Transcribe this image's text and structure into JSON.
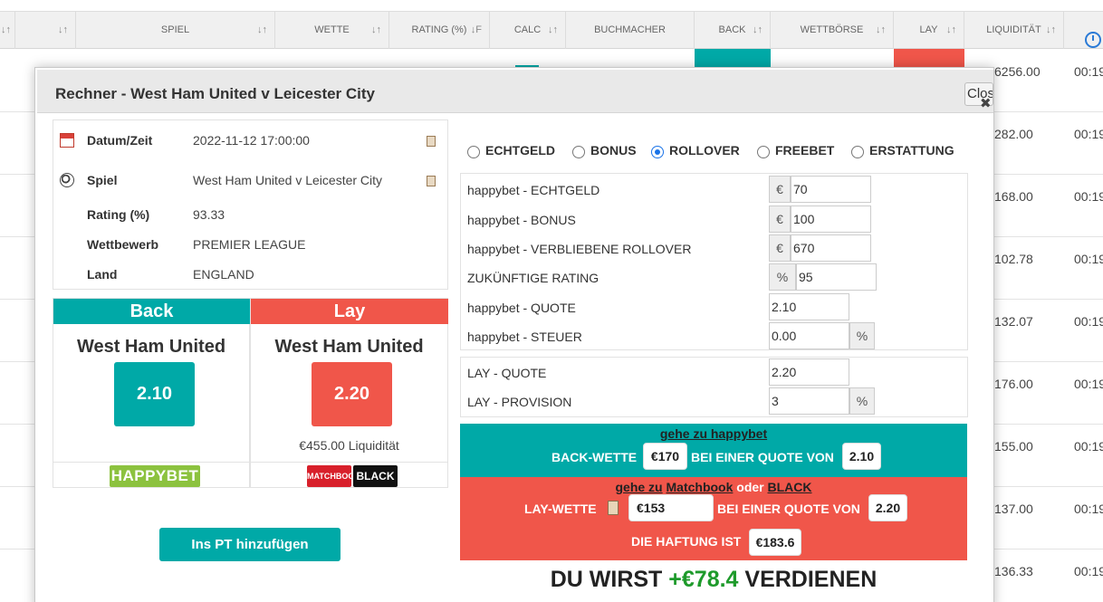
{
  "table": {
    "headers": [
      "SPIEL",
      "WETTE",
      "RATING (%)",
      "CALC",
      "BUCHMACHER",
      "BACK",
      "WETTBÖRSE",
      "LAY",
      "LIQUIDITÄT"
    ],
    "sort_glyph": "↓↑",
    "sort_glyph_rating": "↓F",
    "liquidity_values": [
      "6256.00",
      "282.00",
      "168.00",
      "102.78",
      "132.07",
      "176.00",
      "155.00",
      "137.00",
      "136.33"
    ],
    "time_values": [
      "00:19",
      "00:19",
      "00:19",
      "00:19",
      "00:19",
      "00:19",
      "00:19",
      "00:19",
      "00:19"
    ]
  },
  "modal": {
    "title": "Rechner - West Ham United v Leicester City",
    "close_label": "Close",
    "close_glyph": "✖"
  },
  "info": {
    "rows": [
      {
        "label": "Datum/Zeit",
        "value": "2022-11-12 17:00:00"
      },
      {
        "label": "Spiel",
        "value": "West Ham United v Leicester City"
      },
      {
        "label": "Rating (%)",
        "value": "93.33"
      },
      {
        "label": "Wettbewerb",
        "value": "PREMIER LEAGUE"
      },
      {
        "label": "Land",
        "value": "ENGLAND"
      }
    ]
  },
  "back": {
    "header": "Back",
    "team": "West Ham United",
    "odds": "2.10",
    "bookmaker_logo": "HAPPYBET",
    "color": "#00a9a7"
  },
  "lay": {
    "header": "Lay",
    "team": "West Ham United",
    "odds": "2.20",
    "liquidity": "€455.00 Liquidität",
    "logo_matchbook": "MATCHBOOK",
    "logo_black": "BLACK",
    "color": "#f0564a"
  },
  "pt_button": "Ins PT hinzufügen",
  "bet_types": {
    "options": [
      "ECHTGELD",
      "BONUS",
      "ROLLOVER",
      "FREEBET",
      "ERSTATTUNG"
    ],
    "selected": "ROLLOVER"
  },
  "calc": {
    "currency": "€",
    "percent": "%",
    "rows": [
      {
        "label": "happybet - ECHTGELD",
        "value": "70"
      },
      {
        "label": "happybet - BONUS",
        "value": "100"
      },
      {
        "label": "happybet - VERBLIEBENE ROLLOVER",
        "value": "670"
      },
      {
        "label": "ZUKÜNFTIGE RATING",
        "value": "95"
      },
      {
        "label": "happybet - QUOTE",
        "value": "2.10"
      },
      {
        "label": "happybet - STEUER",
        "value": "0.00"
      }
    ],
    "lay_rows": [
      {
        "label": "LAY - QUOTE",
        "value": "2.20"
      },
      {
        "label": "LAY - PROVISION",
        "value": "3"
      }
    ]
  },
  "result": {
    "back_link": "gehe zu happybet",
    "back_bet_label": "BACK-WETTE",
    "back_stake": "€170",
    "at_odds_label": "BEI EINER QUOTE VON",
    "back_odds": "2.10",
    "lay_link_prefix": "gehe zu",
    "lay_link_matchbook": "Matchbook",
    "lay_link_or": "oder",
    "lay_link_black": "BLACK",
    "lay_bet_label": "LAY-WETTE",
    "lay_stake": "€153",
    "lay_odds": "2.20",
    "liability_label": "DIE HAFTUNG IST",
    "liability": "€183.6",
    "earn_prefix": "DU WIRST",
    "earn_amount": "+€78.4",
    "earn_suffix": "VERDIENEN"
  }
}
